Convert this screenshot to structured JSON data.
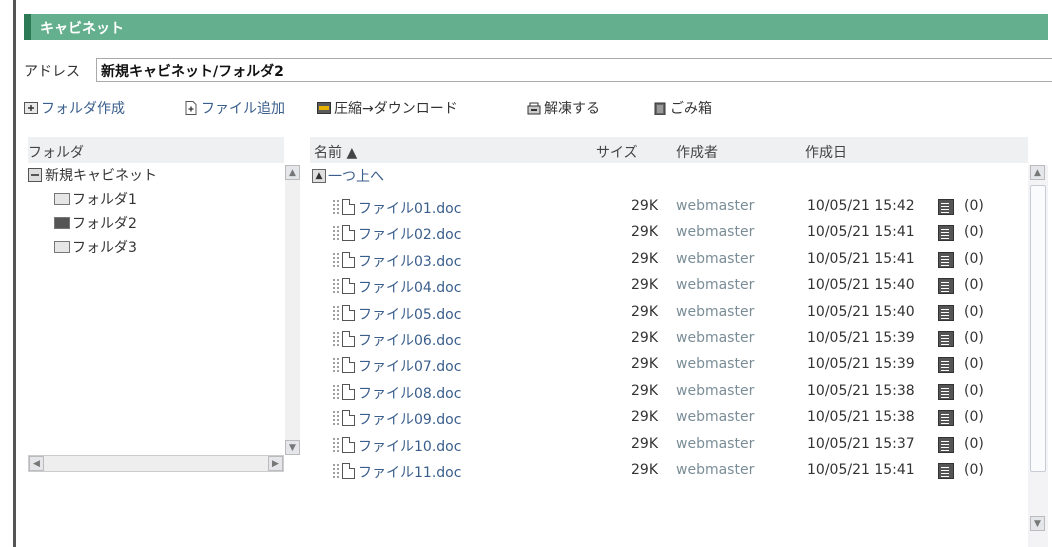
{
  "panel": {
    "title": "キャビネット"
  },
  "address": {
    "label": "アドレス",
    "value": "新規キャビネット/フォルダ2"
  },
  "toolbar": {
    "new_folder": "フォルダ作成",
    "add_file": "ファイル追加",
    "compress_download": "圧縮→ダウンロード",
    "unfreeze": "解凍する",
    "trash": "ごみ箱"
  },
  "columns": {
    "folder": "フォルダ",
    "name": "名前 ▲",
    "size": "サイズ",
    "creator": "作成者",
    "created": "作成日"
  },
  "tree": {
    "root": "新規キャビネット",
    "folders": [
      "フォルダ1",
      "フォルダ2",
      "フォルダ3"
    ],
    "selected_index": 1
  },
  "list": {
    "up_label": "一つ上へ",
    "files": [
      {
        "name": "ファイル01.doc",
        "size": "29K",
        "owner": "webmaster",
        "date": "10/05/21 15:42",
        "count": "(0)"
      },
      {
        "name": "ファイル02.doc",
        "size": "29K",
        "owner": "webmaster",
        "date": "10/05/21 15:41",
        "count": "(0)"
      },
      {
        "name": "ファイル03.doc",
        "size": "29K",
        "owner": "webmaster",
        "date": "10/05/21 15:41",
        "count": "(0)"
      },
      {
        "name": "ファイル04.doc",
        "size": "29K",
        "owner": "webmaster",
        "date": "10/05/21 15:40",
        "count": "(0)"
      },
      {
        "name": "ファイル05.doc",
        "size": "29K",
        "owner": "webmaster",
        "date": "10/05/21 15:40",
        "count": "(0)"
      },
      {
        "name": "ファイル06.doc",
        "size": "29K",
        "owner": "webmaster",
        "date": "10/05/21 15:39",
        "count": "(0)"
      },
      {
        "name": "ファイル07.doc",
        "size": "29K",
        "owner": "webmaster",
        "date": "10/05/21 15:39",
        "count": "(0)"
      },
      {
        "name": "ファイル08.doc",
        "size": "29K",
        "owner": "webmaster",
        "date": "10/05/21 15:38",
        "count": "(0)"
      },
      {
        "name": "ファイル09.doc",
        "size": "29K",
        "owner": "webmaster",
        "date": "10/05/21 15:38",
        "count": "(0)"
      },
      {
        "name": "ファイル10.doc",
        "size": "29K",
        "owner": "webmaster",
        "date": "10/05/21 15:37",
        "count": "(0)"
      },
      {
        "name": "ファイル11.doc",
        "size": "29K",
        "owner": "webmaster",
        "date": "10/05/21 15:41",
        "count": "(0)"
      }
    ]
  },
  "colors": {
    "header_green": "#64b08e",
    "header_dark_green": "#2d7a57",
    "link_blue": "#3a5e8c",
    "owner_gray": "#7a8d97"
  },
  "icons": {
    "new_folder": "folder-plus-icon",
    "add_file": "file-plus-icon",
    "compress": "zip-icon",
    "unfreeze": "archive-icon",
    "trash": "trash-icon",
    "file": "document-icon",
    "note": "note-icon",
    "up": "up-folder-icon"
  }
}
